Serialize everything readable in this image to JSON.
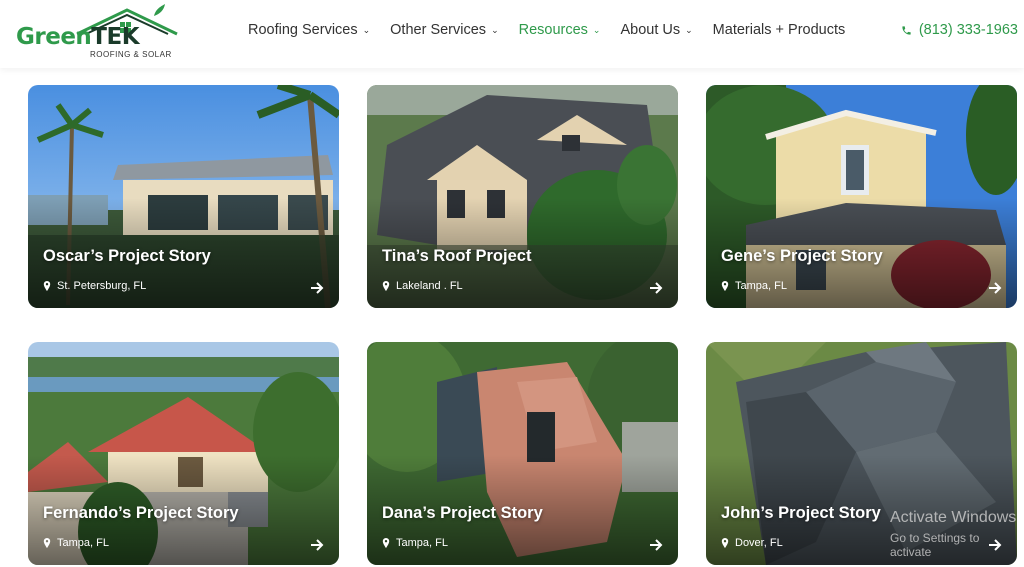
{
  "brand": {
    "name_part1": "Green",
    "name_part2": "TEK",
    "tagline": "ROOFING & SOLAR",
    "colors": {
      "green": "#2f9a4b",
      "dark": "#1a3b2a"
    }
  },
  "nav": {
    "items": [
      {
        "label": "Roofing Services",
        "has_dropdown": true,
        "active": false
      },
      {
        "label": "Other Services",
        "has_dropdown": true,
        "active": false
      },
      {
        "label": "Resources",
        "has_dropdown": true,
        "active": true
      },
      {
        "label": "About Us",
        "has_dropdown": true,
        "active": false
      },
      {
        "label": "Materials + Products",
        "has_dropdown": false,
        "active": false
      }
    ],
    "phone": "(813) 333-1963",
    "phone_icon": "phone-icon"
  },
  "projects": [
    {
      "title": "Oscar’s Project Story",
      "location": "St. Petersburg, FL",
      "image": "coastal-house-with-palms"
    },
    {
      "title": "Tina’s Roof Project",
      "location": "Lakeland . FL",
      "image": "aerial-gray-shingle-roof"
    },
    {
      "title": "Gene’s Project Story",
      "location": "Tampa, FL",
      "image": "two-story-stucco-house"
    },
    {
      "title": "Fernando’s Project Story",
      "location": "Tampa, FL",
      "image": "red-tile-roof-lakeside"
    },
    {
      "title": "Dana’s Project Story",
      "location": "Tampa, FL",
      "image": "aerial-tile-roof-trees"
    },
    {
      "title": "John’s Project Story",
      "location": "Dover, FL",
      "image": "metal-standing-seam-roof"
    }
  ],
  "os_overlay": {
    "line1": "Activate Windows",
    "line2": "Go to Settings to activate"
  }
}
